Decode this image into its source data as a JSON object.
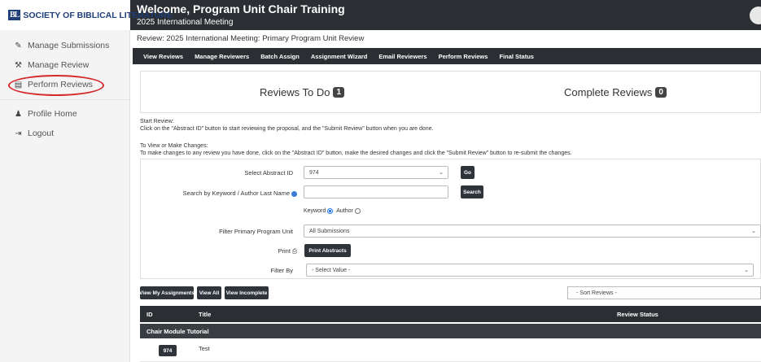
{
  "header": {
    "logo_mark": "BL",
    "logo_text": "SOCIETY OF BIBLICAL LITERATURE",
    "welcome_title": "Welcome, Program Unit Chair Training",
    "welcome_subtitle": "2025 International Meeting"
  },
  "sidebar": {
    "items": [
      {
        "label": "Manage Submissions",
        "icon": "pencil-icon"
      },
      {
        "label": "Manage Review",
        "icon": "gavel-icon"
      },
      {
        "label": "Perform Reviews",
        "icon": "clipboard-icon"
      },
      {
        "label": "Profile Home",
        "icon": "user-icon"
      },
      {
        "label": "Logout",
        "icon": "logout-icon"
      }
    ],
    "highlight_color": "#d42a2a"
  },
  "page": {
    "title": "Review: 2025 International Meeting: Primary Program Unit Review"
  },
  "nav": {
    "items": [
      "View Reviews",
      "Manage Reviewers",
      "Batch Assign",
      "Assignment Wizard",
      "Email Reviewers",
      "Perform Reviews",
      "Final Status"
    ]
  },
  "summary": {
    "todo_label": "Reviews To Do",
    "todo_count": "1",
    "complete_label": "Complete Reviews",
    "complete_count": "0"
  },
  "instructions": {
    "start_heading": "Start Review:",
    "start_text": "Click on the \"Abstract ID\" button to start reviewing the proposal, and the \"Submit Review\" button when you are done.",
    "change_heading": "To View or Make Changes:",
    "change_text": "To make changes to any review you have done, click on the \"Abstract ID\" button, make the desired changes and click the \"Submit Review\" button to re-submit the changes."
  },
  "filters": {
    "select_abstract_label": "Select Abstract ID",
    "select_abstract_value": "974",
    "go_label": "Go",
    "search_label": "Search by Keyword / Author Last Name",
    "search_value": "",
    "search_button": "Search",
    "radio_keyword": "Keyword",
    "radio_author": "Author",
    "filter_unit_label": "Filter Primary Program Unit",
    "filter_unit_value": "All Submissions",
    "print_label": "Print",
    "print_button": "Print Abstracts",
    "filter_by_label": "Filter By",
    "filter_by_value": "- Select Value -"
  },
  "table_controls": {
    "view_my": "View My Assignments",
    "view_all": "View All",
    "view_incomplete": "View Incomplete",
    "sort_placeholder": "- Sort Reviews -"
  },
  "table": {
    "columns": [
      "ID",
      "Title",
      "Review Status"
    ],
    "group": "Chair Module Tutorial",
    "rows": [
      {
        "id": "974",
        "title": "Test",
        "status": ""
      }
    ]
  }
}
